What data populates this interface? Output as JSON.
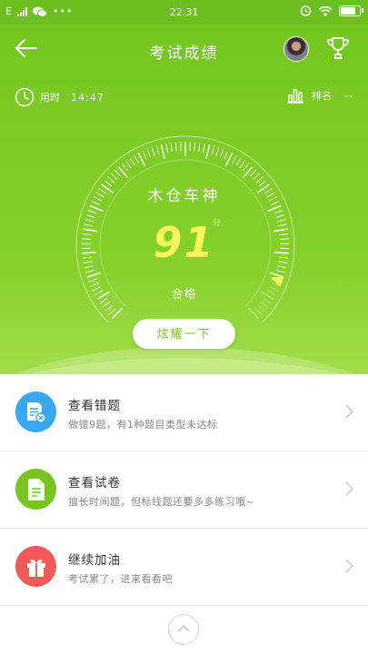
{
  "status_bar": {
    "carrier": "E",
    "time": "22:31",
    "battery_level": 0.9
  },
  "header": {
    "title": "考试成绩"
  },
  "stats": {
    "time_label": "用时",
    "time_value": "14:47",
    "rank_label": "排名",
    "rank_value": "--"
  },
  "result": {
    "name": "木仓车神",
    "score": "91",
    "score_unit": "分",
    "score_fraction": 0.91,
    "status": "合格"
  },
  "share_button": "炫耀一下",
  "actions": [
    {
      "title": "查看错题",
      "subtitle": "做错9题，有1种题目类型未达标",
      "icon": "wrong-questions-icon",
      "color": "#3aa8f0"
    },
    {
      "title": "查看试卷",
      "subtitle": "擅长时间题，但标线题还要多多练习哦~",
      "icon": "exam-paper-icon",
      "color": "#78c51f"
    },
    {
      "title": "继续加油",
      "subtitle": "考试累了，进来看看吧",
      "icon": "gift-icon",
      "color": "#f25a5a"
    }
  ],
  "colors": {
    "primary_green": "#74c61f",
    "score_yellow": "#fbf75b"
  }
}
